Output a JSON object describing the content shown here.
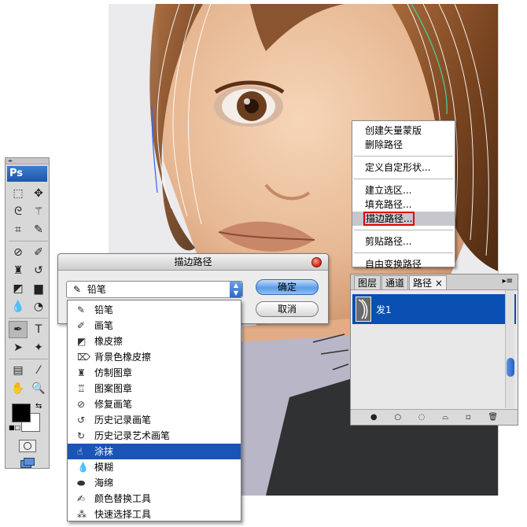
{
  "context_menu": {
    "items": [
      "创建矢量蒙版",
      "删除路径",
      "定义自定形状...",
      "建立选区...",
      "填充路径...",
      "描边路径...",
      "剪贴路径...",
      "自由变换路径"
    ],
    "highlight_text": "描边路径",
    "highlight_color": "#e00000"
  },
  "dialog": {
    "title": "描边路径",
    "tool_value": "铅笔",
    "ok_label": "确定",
    "cancel_label": "取消"
  },
  "dropdown": {
    "items": [
      {
        "label": "铅笔",
        "icon": "pencil-icon"
      },
      {
        "label": "画笔",
        "icon": "brush-icon"
      },
      {
        "label": "橡皮擦",
        "icon": "eraser-icon"
      },
      {
        "label": "背景色橡皮擦",
        "icon": "background-eraser-icon"
      },
      {
        "label": "仿制图章",
        "icon": "clone-stamp-icon"
      },
      {
        "label": "图案图章",
        "icon": "pattern-stamp-icon"
      },
      {
        "label": "修复画笔",
        "icon": "healing-brush-icon"
      },
      {
        "label": "历史记录画笔",
        "icon": "history-brush-icon"
      },
      {
        "label": "历史记录艺术画笔",
        "icon": "art-history-brush-icon"
      },
      {
        "label": "涂抹",
        "icon": "smudge-icon"
      },
      {
        "label": "模糊",
        "icon": "blur-icon"
      },
      {
        "label": "海绵",
        "icon": "sponge-icon"
      },
      {
        "label": "颜色替换工具",
        "icon": "color-replacement-icon"
      },
      {
        "label": "快速选择工具",
        "icon": "quick-selection-icon"
      }
    ],
    "selected_index": 9,
    "selected_color": "#1a54b7"
  },
  "paths_panel": {
    "tabs": [
      "图层",
      "通道",
      "路径"
    ],
    "active_tab": "路径",
    "path_name": "发1",
    "row_color": "#0a4fb2"
  },
  "toolbox": {
    "logo": "Ps"
  }
}
